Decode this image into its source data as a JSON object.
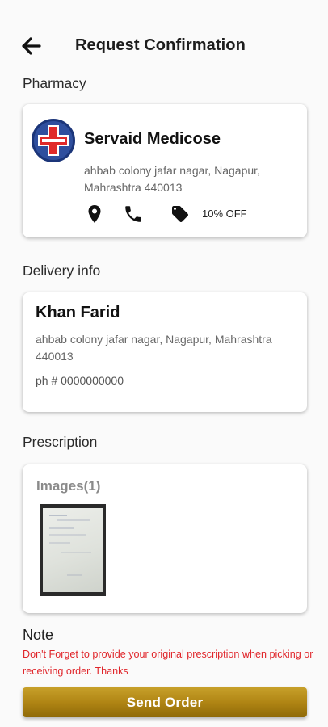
{
  "header": {
    "title": "Request Confirmation",
    "back_icon": "arrow-left-icon"
  },
  "pharmacy": {
    "section_label": "Pharmacy",
    "name": "Servaid Medicose",
    "address": "ahbab colony jafar nagar, Nagapur, Mahrashtra 440013",
    "discount": "10% OFF",
    "icons": [
      "location-pin-icon",
      "phone-icon",
      "tag-icon"
    ],
    "logo": "pharmacy-cross-logo"
  },
  "delivery": {
    "section_label": "Delivery info",
    "name": "Khan Farid",
    "address": "ahbab colony jafar nagar, Nagapur, Mahrashtra 440013",
    "phone": "ph # 0000000000"
  },
  "prescription": {
    "section_label": "Prescription",
    "images_label": "Images(1)"
  },
  "note": {
    "label": "Note",
    "text": "Don't Forget to provide your original prescription when picking or receiving order. Thanks"
  },
  "actions": {
    "send_label": "Send Order"
  },
  "colors": {
    "accent_gold": "#b08514",
    "warning_red": "#e0262b",
    "logo_blue": "#2f4f9e",
    "logo_red": "#e02a2a"
  }
}
